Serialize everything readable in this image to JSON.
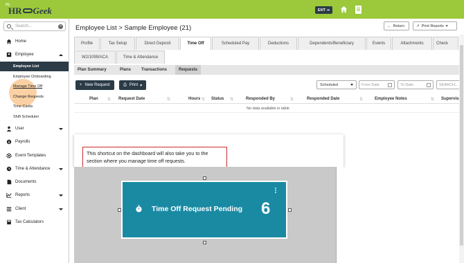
{
  "header": {
    "logo_my": "My",
    "logo_hr": "HR",
    "logo_geek": "Geek",
    "exit_label": "EXIT",
    "home_icon": "home-icon",
    "document_icon": "document-icon"
  },
  "sidebar": {
    "search_placeholder": "Search...",
    "items": {
      "home": "Home",
      "employee": "Employee",
      "user": "User",
      "payrolls": "Payrolls",
      "event_templates": "Event Templates",
      "time_attendance": "Time & Attendance",
      "documents": "Documents",
      "reports": "Reports",
      "client": "Client",
      "tax_calculators": "Tax Calculators"
    },
    "employee_sub": {
      "list": "Employee List",
      "onboarding": "Employee Onboarding",
      "manage_time_off": "Manage Time Off",
      "change_requests": "Change Requests",
      "time_cards": "Time Cards",
      "shift_scheduler": "Shift Scheduler"
    }
  },
  "main": {
    "title": "Employee List > Sample Employee (21)",
    "return_label": "Return",
    "print_reports_label": "Print Reports",
    "tabs_row1": [
      "Profile",
      "Tax Setup",
      "Direct Deposit",
      "Time Off",
      "Scheduled Pay",
      "Deductions",
      "Dependents/Beneficiary",
      "Events",
      "Attachments",
      "Check"
    ],
    "tabs_row2": [
      "W2/1099/ACA",
      "Time & Attendance"
    ],
    "subtabs": [
      "Plan Summary",
      "Plans",
      "Transactions",
      "Requests"
    ],
    "new_request_label": "New Request",
    "print_label": "Print",
    "status_filter": "Scheduled",
    "from_date_placeholder": "From Date",
    "to_date_placeholder": "To Date",
    "search_placeholder": "SEARCH...",
    "table_headers": [
      "Plan",
      "Request Date",
      "Hours",
      "Status",
      "Responded By",
      "Responded Date",
      "Employee Notes",
      "Supervisor"
    ],
    "no_data": "No data available in table"
  },
  "callout": {
    "text": "This shortcut on the dashboard will also take you to the section where you manage time off requests."
  },
  "widget": {
    "label": "Time Off Request Pending",
    "count": "6"
  },
  "colors": {
    "topbar": "#9cc83b",
    "dark": "#2b3b47",
    "widget": "#1a8aa3",
    "callout_border": "#cc2a2a"
  }
}
